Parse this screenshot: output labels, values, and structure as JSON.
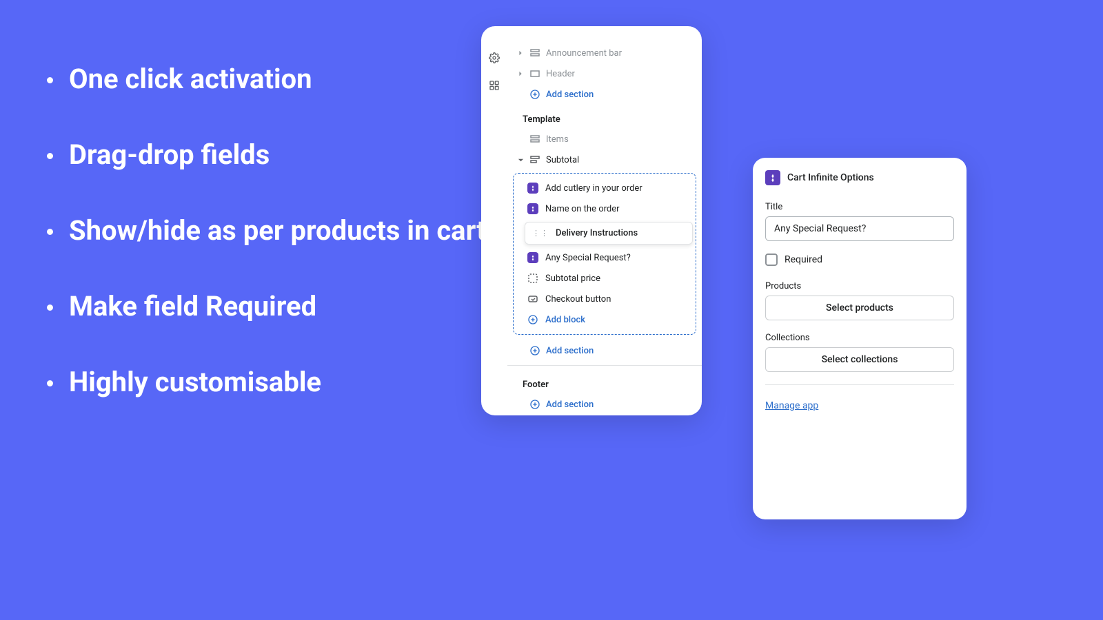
{
  "features": [
    "One click activation",
    "Drag-drop fields",
    "Show/hide as per products in cart",
    "Make field Required",
    "Highly customisable"
  ],
  "panelA": {
    "rows": {
      "announcement": "Announcement bar",
      "header": "Header",
      "addSection1": "Add section"
    },
    "templateTitle": "Template",
    "items": "Items",
    "subtotal": "Subtotal",
    "blocks": {
      "cutlery": "Add cutlery in your order",
      "name": "Name on the order",
      "delivery": "Delivery Instructions",
      "special": "Any Special Request?",
      "price": "Subtotal price",
      "checkout": "Checkout button",
      "addBlock": "Add block"
    },
    "addSection2": "Add section",
    "footerTitle": "Footer",
    "addSection3": "Add section"
  },
  "panelB": {
    "appName": "Cart Infinite Options",
    "titleLabel": "Title",
    "titleValue": "Any Special Request?",
    "required": "Required",
    "productsLabel": "Products",
    "selectProducts": "Select products",
    "collectionsLabel": "Collections",
    "selectCollections": "Select collections",
    "manage": "Manage app"
  }
}
